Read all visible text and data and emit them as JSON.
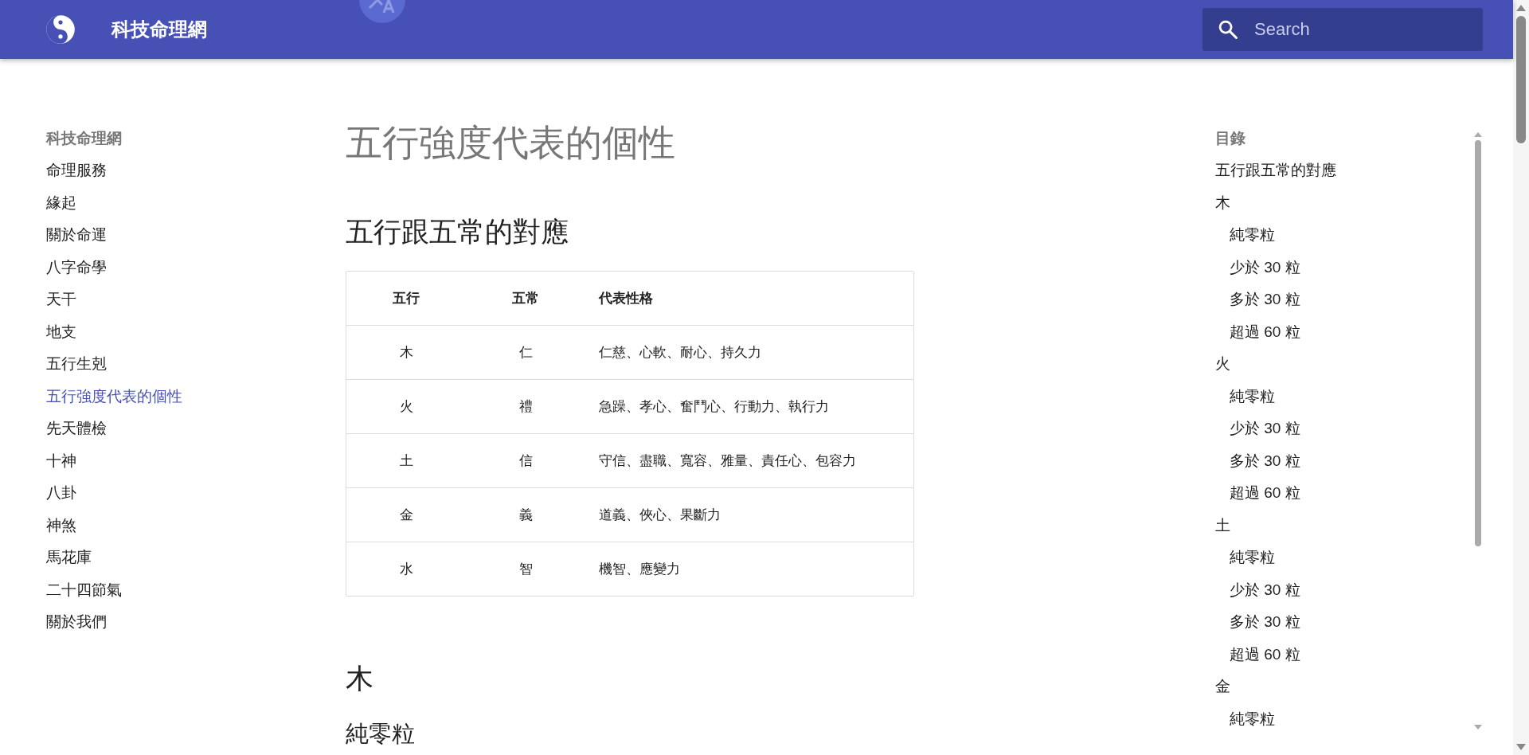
{
  "header": {
    "site_title": "科技命理網",
    "search": {
      "placeholder": "Search"
    }
  },
  "sidebar": {
    "title": "科技命理網",
    "items": [
      {
        "label": "命理服務",
        "selected": false
      },
      {
        "label": "緣起",
        "selected": false
      },
      {
        "label": "關於命運",
        "selected": false
      },
      {
        "label": "八字命學",
        "selected": false
      },
      {
        "label": "天干",
        "selected": false
      },
      {
        "label": "地支",
        "selected": false
      },
      {
        "label": "五行生剋",
        "selected": false
      },
      {
        "label": "五行強度代表的個性",
        "selected": true
      },
      {
        "label": "先天體檢",
        "selected": false
      },
      {
        "label": "十神",
        "selected": false
      },
      {
        "label": "八卦",
        "selected": false
      },
      {
        "label": "神煞",
        "selected": false
      },
      {
        "label": "馬花庫",
        "selected": false
      },
      {
        "label": "二十四節氣",
        "selected": false
      },
      {
        "label": "關於我們",
        "selected": false
      }
    ]
  },
  "article": {
    "title": "五行強度代表的個性",
    "section_heading": "五行跟五常的對應",
    "table": {
      "columns": [
        "五行",
        "五常",
        "代表性格"
      ],
      "rows": [
        [
          "木",
          "仁",
          "仁慈、心軟、耐心、持久力"
        ],
        [
          "火",
          "禮",
          "急躁、孝心、奮鬥心、行動力、執行力"
        ],
        [
          "土",
          "信",
          "守信、盡職、寬容、雅量、責任心、包容力"
        ],
        [
          "金",
          "義",
          "道義、俠心、果斷力"
        ],
        [
          "水",
          "智",
          "機智、應變力"
        ]
      ]
    },
    "next_heading": "木",
    "next_subheading": "純零粒"
  },
  "toc": {
    "title": "目錄",
    "items": [
      {
        "label": "五行跟五常的對應"
      },
      {
        "label": "木",
        "children": [
          {
            "label": "純零粒"
          },
          {
            "label": "少於 30 粒"
          },
          {
            "label": "多於 30 粒"
          },
          {
            "label": "超過 60 粒"
          }
        ]
      },
      {
        "label": "火",
        "children": [
          {
            "label": "純零粒"
          },
          {
            "label": "少於 30 粒"
          },
          {
            "label": "多於 30 粒"
          },
          {
            "label": "超過 60 粒"
          }
        ]
      },
      {
        "label": "土",
        "children": [
          {
            "label": "純零粒"
          },
          {
            "label": "少於 30 粒"
          },
          {
            "label": "多於 30 粒"
          },
          {
            "label": "超過 60 粒"
          }
        ]
      },
      {
        "label": "金",
        "children": [
          {
            "label": "純零粒"
          }
        ]
      }
    ]
  }
}
